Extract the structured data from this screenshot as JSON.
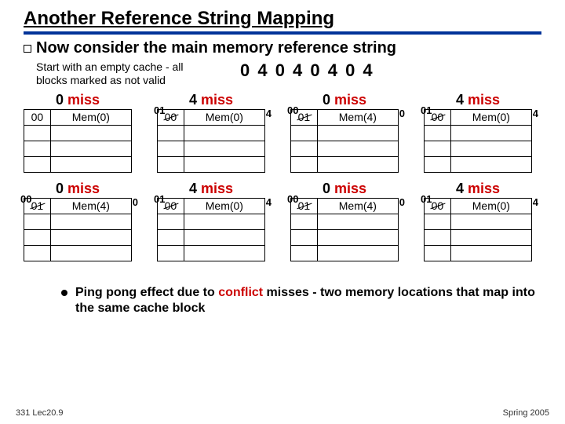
{
  "title": "Another Reference String Mapping",
  "main_line": "Now consider the main memory reference string",
  "sub_line": "Start with an empty cache - all blocks marked as not valid",
  "ref_string": "0  4  0  4  0  4  0  4",
  "miss_label": "miss",
  "rows": [
    [
      {
        "head_num": "0",
        "c0": "00",
        "c1": "Mem(0)",
        "tl": "",
        "tr": "",
        "br": ""
      },
      {
        "head_num": "4",
        "c0_strike": "00",
        "c1": "Mem(0)",
        "tl": "01",
        "tr": "4",
        "br": ""
      },
      {
        "head_num": "0",
        "c0_strike": "01",
        "c1": "Mem(4)",
        "tl": "00",
        "tr": "0",
        "br": ""
      },
      {
        "head_num": "4",
        "c0_strike": "00",
        "c1": "Mem(0)",
        "tl": "01",
        "tr": "4",
        "br": ""
      }
    ],
    [
      {
        "head_num": "0",
        "c0_strike": "01",
        "c1": "Mem(4)",
        "tl": "00",
        "tr": "0",
        "br": ""
      },
      {
        "head_num": "4",
        "c0_strike": "00",
        "c1": "Mem(0)",
        "tl": "01",
        "tr": "4",
        "br": ""
      },
      {
        "head_num": "0",
        "c0_strike": "01",
        "c1": "Mem(4)",
        "tl": "00",
        "tr": "0",
        "br": ""
      },
      {
        "head_num": "4",
        "c0_strike": "00",
        "c1": "Mem(0)",
        "tl": "01",
        "tr": "4",
        "br": ""
      }
    ]
  ],
  "footnote_pre": "Ping pong effect due to ",
  "footnote_red": "conflict",
  "footnote_post": " misses - two memory locations that map into the same cache block",
  "footer_left": "331 Lec20.9",
  "footer_right": "Spring 2005"
}
